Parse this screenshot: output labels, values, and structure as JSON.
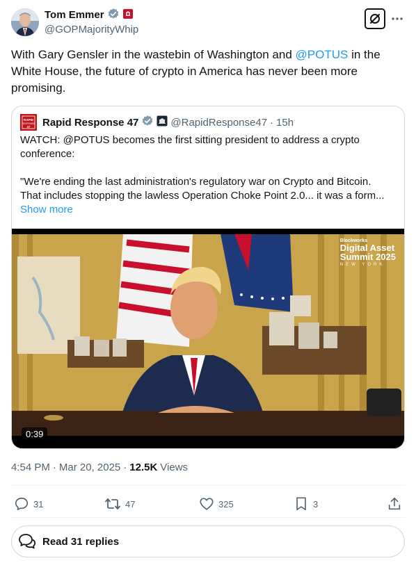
{
  "author": {
    "name": "Tom Emmer",
    "handle": "@GOPMajorityWhip"
  },
  "tweet": {
    "text_before": "With Gary Gensler in the wastebin of Washington and ",
    "mention": "@POTUS",
    "text_after": " in the White House, the future of crypto in America has never been more promising."
  },
  "quote": {
    "name": "Rapid Response 47",
    "handle": "@RapidResponse47",
    "separator": "·",
    "time": "15h",
    "avatar_text": "RAPID RESPONSE 47",
    "line1": "WATCH: @POTUS becomes the first sitting president to address a crypto",
    "line2": "conference:",
    "line3": "\"We're ending the last administration's regulatory war on Crypto and Bitcoin.",
    "line4": "That includes stopping the lawless Operation Choke Point 2.0... it was a form...",
    "show_more": "Show more",
    "video": {
      "duration": "0:39",
      "overlay_small": "Blockworks",
      "overlay_line1": "Digital Asset",
      "overlay_line2": "Summit 2025",
      "overlay_city": "NEW YORK"
    }
  },
  "meta": {
    "time": "4:54 PM",
    "dot1": "·",
    "date": "Mar 20, 2025",
    "dot2": "·",
    "views_count": "12.5K",
    "views_label": "Views"
  },
  "actions": {
    "replies": "31",
    "reposts": "47",
    "likes": "325",
    "bookmarks": "3"
  },
  "read_replies": "Read 31 replies",
  "colors": {
    "accent": "#1d9bf0",
    "verified_gray": "#829aab",
    "text": "#0f1419",
    "muted": "#536471"
  }
}
